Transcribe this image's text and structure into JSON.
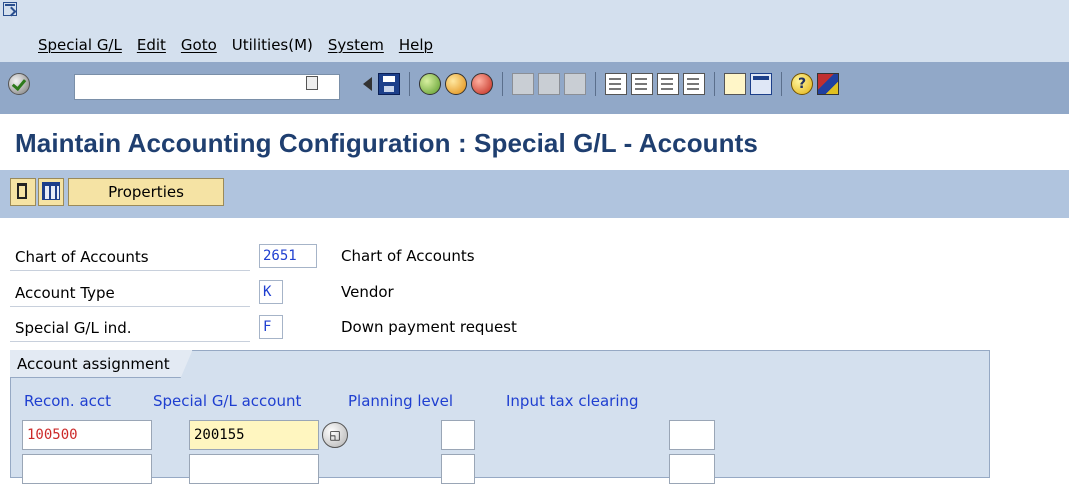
{
  "menubar": {
    "items": [
      {
        "label": "Special G/L"
      },
      {
        "label": "Edit"
      },
      {
        "label": "Goto"
      },
      {
        "label": "Utilities(M)"
      },
      {
        "label": "System"
      },
      {
        "label": "Help"
      }
    ]
  },
  "toolbar": {
    "command_field_value": "",
    "icons": [
      "enter-check-icon",
      "save-icon",
      "back-icon",
      "exit-icon",
      "cancel-icon",
      "print-icon",
      "find-icon",
      "find-next-icon",
      "first-page-icon",
      "previous-page-icon",
      "next-page-icon",
      "last-page-icon",
      "create-session-icon",
      "shortcut-icon",
      "help-icon",
      "customize-layout-icon"
    ]
  },
  "page": {
    "title": "Maintain Accounting Configuration : Special G/L - Accounts"
  },
  "app_toolbar": {
    "properties_label": "Properties"
  },
  "header_fields": [
    {
      "label": "Chart of Accounts",
      "value": "2651",
      "description": "Chart of Accounts"
    },
    {
      "label": "Account Type",
      "value": "K",
      "description": "Vendor"
    },
    {
      "label": "Special G/L ind.",
      "value": "F",
      "description": "Down payment request"
    }
  ],
  "account_assignment": {
    "tab_label": "Account assignment",
    "columns": [
      "Recon. acct",
      "Special G/L account",
      "Planning level",
      "Input tax clearing"
    ],
    "rows": [
      {
        "recon_acct": "100500",
        "special_gl_account": "200155",
        "planning_level": "",
        "input_tax_clearing": ""
      },
      {
        "recon_acct": "",
        "special_gl_account": "",
        "planning_level": "",
        "input_tax_clearing": ""
      }
    ]
  },
  "colors": {
    "menu_bg": "#d4e0ee",
    "toolbar_bg": "#91a8c8",
    "title_color": "#1f3f70",
    "field_value_color": "#1f3fd0",
    "recon_value_color": "#cc2a2a"
  }
}
